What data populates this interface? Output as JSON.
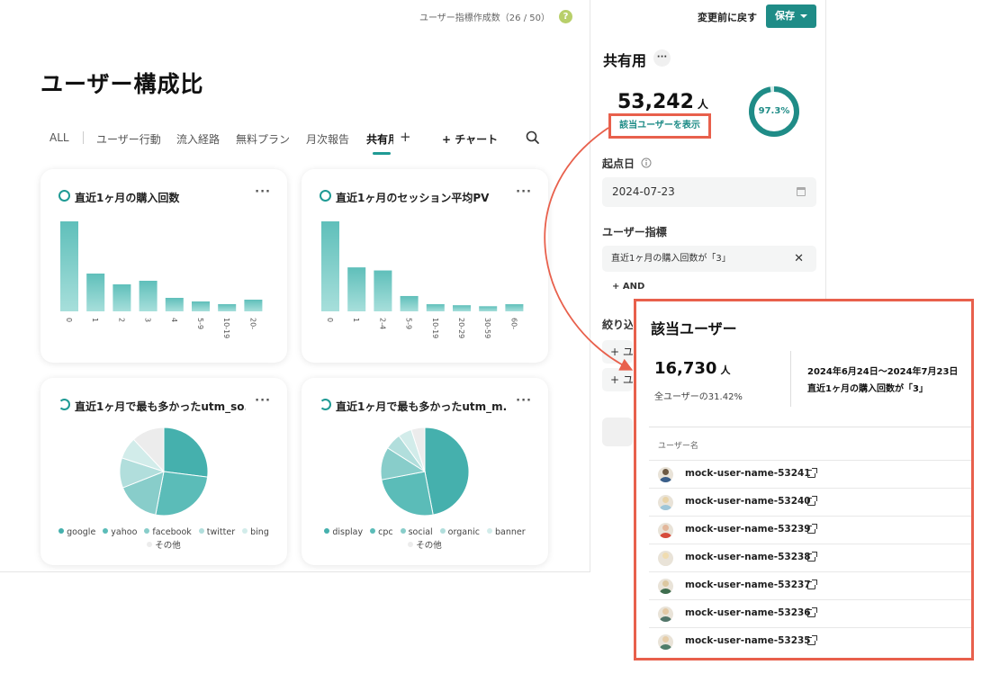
{
  "header": {
    "usage_counter": "ユーザー指標作成数（26 / 50）",
    "help_icon": "question-icon"
  },
  "page": {
    "title": "ユーザー構成比"
  },
  "tabs": [
    {
      "label": "ALL",
      "active": false
    },
    {
      "label": "ユーザー行動",
      "active": false
    },
    {
      "label": "流入経路",
      "active": false
    },
    {
      "label": "無料プラン",
      "active": false
    },
    {
      "label": "月次報告",
      "active": false
    },
    {
      "label": "共有用",
      "active": true
    }
  ],
  "tab_actions": {
    "add_tab": "+",
    "add_chart": "+ チャート",
    "search_icon": "search-icon"
  },
  "cards": [
    {
      "title": "直近1ヶ月の購入回数",
      "more": "···"
    },
    {
      "title": "直近1ヶ月のセッション平均PV",
      "more": "···"
    },
    {
      "title": "直近1ヶ月で最も多かったutm_so...",
      "more": "···"
    },
    {
      "title": "直近1ヶ月で最も多かったutm_m...",
      "more": "···"
    }
  ],
  "chart_data": [
    {
      "type": "bar",
      "title": "直近1ヶ月の購入回数",
      "categories": [
        "0",
        "1",
        "2",
        "3",
        "4",
        "5-9",
        "10-19",
        "20-"
      ],
      "values": [
        100,
        42,
        30,
        34,
        15,
        11,
        8,
        13
      ],
      "color": "#7fcfc9"
    },
    {
      "type": "bar",
      "title": "直近1ヶ月のセッション平均PV",
      "categories": [
        "0",
        "1",
        "2-4",
        "5-9",
        "10-19",
        "20-29",
        "30-59",
        "60-"
      ],
      "values": [
        88,
        43,
        40,
        15,
        7,
        6,
        5,
        7
      ],
      "color": "#7fcfc9"
    },
    {
      "type": "pie",
      "title": "直近1ヶ月で最も多かったutm_so...",
      "labels": [
        "google",
        "yahoo",
        "facebook",
        "twitter",
        "bing",
        "その他"
      ],
      "values": [
        27,
        26,
        16,
        11,
        8,
        12
      ],
      "colors": [
        "#45b0ad",
        "#5bbcb8",
        "#88cdca",
        "#b1dedc",
        "#d2ecea",
        "#ececec"
      ]
    },
    {
      "type": "pie",
      "title": "直近1ヶ月で最も多かったutm_m...",
      "labels": [
        "display",
        "cpc",
        "social",
        "organic",
        "banner",
        "その他"
      ],
      "values": [
        47,
        25,
        12,
        6,
        5,
        5
      ],
      "colors": [
        "#45b0ad",
        "#5bbcb8",
        "#88cdca",
        "#b1dedc",
        "#d2ecea",
        "#ececec"
      ]
    }
  ],
  "panel": {
    "revert": "変更前に戻す",
    "save": "保存",
    "title": "共有用",
    "more": "···",
    "count": "53,242",
    "count_unit": "人",
    "show_users": "該当ユーザーを表示",
    "ratio": 97.3,
    "ratio_label": "97.3%",
    "start_date_label": "起点日",
    "start_date_value": "2024-07-23",
    "metric_label": "ユーザー指標",
    "metric_condition": "直近1ヶ月の購入回数が「3」",
    "and_button": "+ AND",
    "narrow_label": "絞り込み",
    "narrow_row_1": "+ ユ",
    "narrow_row_2": "+ ユ",
    "accent": "#1f8c87"
  },
  "popup": {
    "title": "該当ユーザー",
    "count": "16,730",
    "count_unit": "人",
    "ratio": "全ユーザーの31.42%",
    "period": "2024年6月24日〜2024年7月23日",
    "condition": "直近1ヶ月の購入回数が「3」",
    "column_header": "ユーザー名",
    "users": [
      "mock-user-name-53241",
      "mock-user-name-53240",
      "mock-user-name-53239",
      "mock-user-name-53238",
      "mock-user-name-53237",
      "mock-user-name-53236",
      "mock-user-name-53235"
    ],
    "highlight": "#e8604c"
  }
}
